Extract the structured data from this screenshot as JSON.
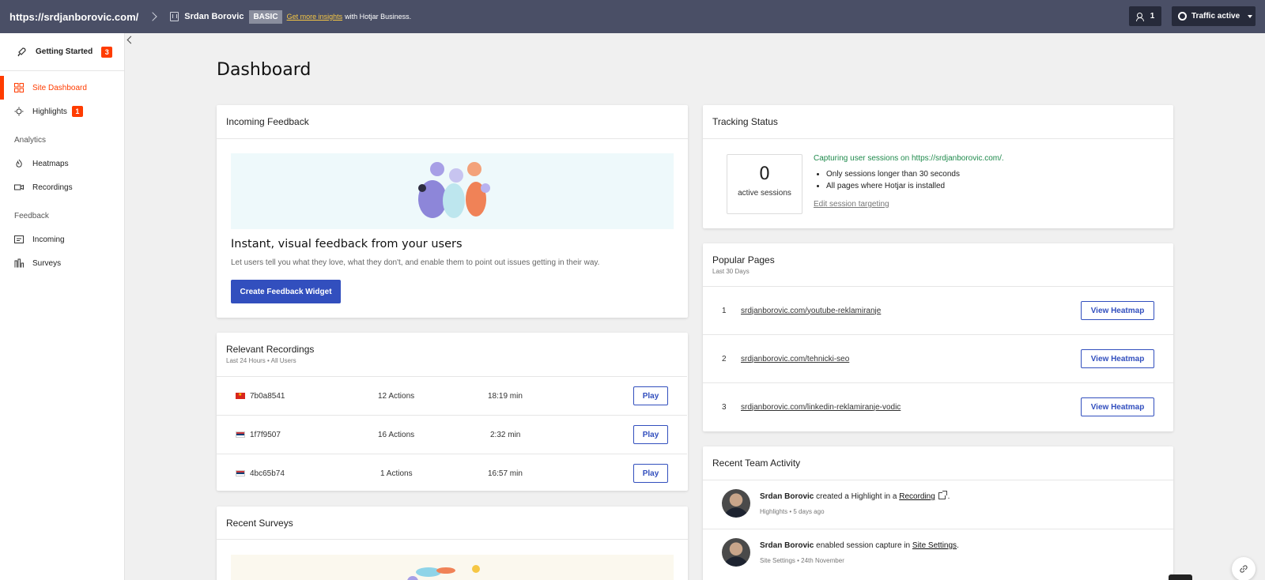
{
  "topbar": {
    "site_url": "https://srdjanborovic.com/",
    "owner": "Srdan Borovic",
    "plan": "BASIC",
    "upsell_link": "Get more insights",
    "upsell_suffix": "with Hotjar Business.",
    "user_count": "1",
    "traffic": "Traffic active"
  },
  "sidebar": {
    "getting_started": {
      "label": "Getting Started",
      "badge": "3"
    },
    "items": [
      {
        "label": "Site Dashboard",
        "icon": "dashboard-icon",
        "active": true
      },
      {
        "label": "Highlights",
        "icon": "bulb-icon",
        "badge": "1"
      }
    ],
    "analytics": {
      "title": "Analytics",
      "items": [
        {
          "label": "Heatmaps",
          "icon": "flame-icon"
        },
        {
          "label": "Recordings",
          "icon": "camera-icon"
        }
      ]
    },
    "feedback": {
      "title": "Feedback",
      "items": [
        {
          "label": "Incoming",
          "icon": "inbox-icon"
        },
        {
          "label": "Surveys",
          "icon": "bar-chart-icon"
        }
      ]
    }
  },
  "page_title": "Dashboard",
  "incoming_feedback": {
    "title": "Incoming Feedback",
    "headline": "Instant, visual feedback from your users",
    "description": "Let users tell you what they love, what they don't, and enable them to point out issues getting in their way.",
    "button": "Create Feedback Widget"
  },
  "relevant_recordings": {
    "title": "Relevant Recordings",
    "subtitle": "Last 24 Hours • All Users",
    "play_label": "Play",
    "rows": [
      {
        "flag": "vn",
        "id": "7b0a8541",
        "actions": "12 Actions",
        "duration": "18:19 min"
      },
      {
        "flag": "rs",
        "id": "1f7f9507",
        "actions": "16 Actions",
        "duration": "2:32 min"
      },
      {
        "flag": "rs",
        "id": "4bc65b74",
        "actions": "1 Actions",
        "duration": "16:57 min"
      }
    ]
  },
  "recent_surveys": {
    "title": "Recent Surveys"
  },
  "tracking_status": {
    "title": "Tracking Status",
    "count": "0",
    "count_label": "active sessions",
    "capturing": "Capturing user sessions on https://srdjanborovic.com/.",
    "bullets": [
      "Only sessions longer than 30 seconds",
      "All pages where Hotjar is installed"
    ],
    "edit_link": "Edit session targeting"
  },
  "popular_pages": {
    "title": "Popular Pages",
    "subtitle": "Last 30 Days",
    "button_label": "View Heatmap",
    "rows": [
      {
        "rank": "1",
        "url": "srdjanborovic.com/youtube-reklamiranje"
      },
      {
        "rank": "2",
        "url": "srdjanborovic.com/tehnicki-seo"
      },
      {
        "rank": "3",
        "url": "srdjanborovic.com/linkedin-reklamiranje-vodic"
      }
    ]
  },
  "team_activity": {
    "title": "Recent Team Activity",
    "rows": [
      {
        "name": "Srdan Borovic",
        "action": "created a Highlight in a",
        "target": "Recording",
        "end": ".",
        "meta": "Highlights • 5 days ago"
      },
      {
        "name": "Srdan Borovic",
        "action": "enabled session capture in",
        "target": "Site Settings",
        "end": ".",
        "meta": "Site Settings • 24th November"
      }
    ]
  },
  "colors": {
    "accent": "#ff3c00",
    "primary": "#324fbe",
    "topbar": "#4a4f66",
    "success": "#1f8a4c"
  }
}
